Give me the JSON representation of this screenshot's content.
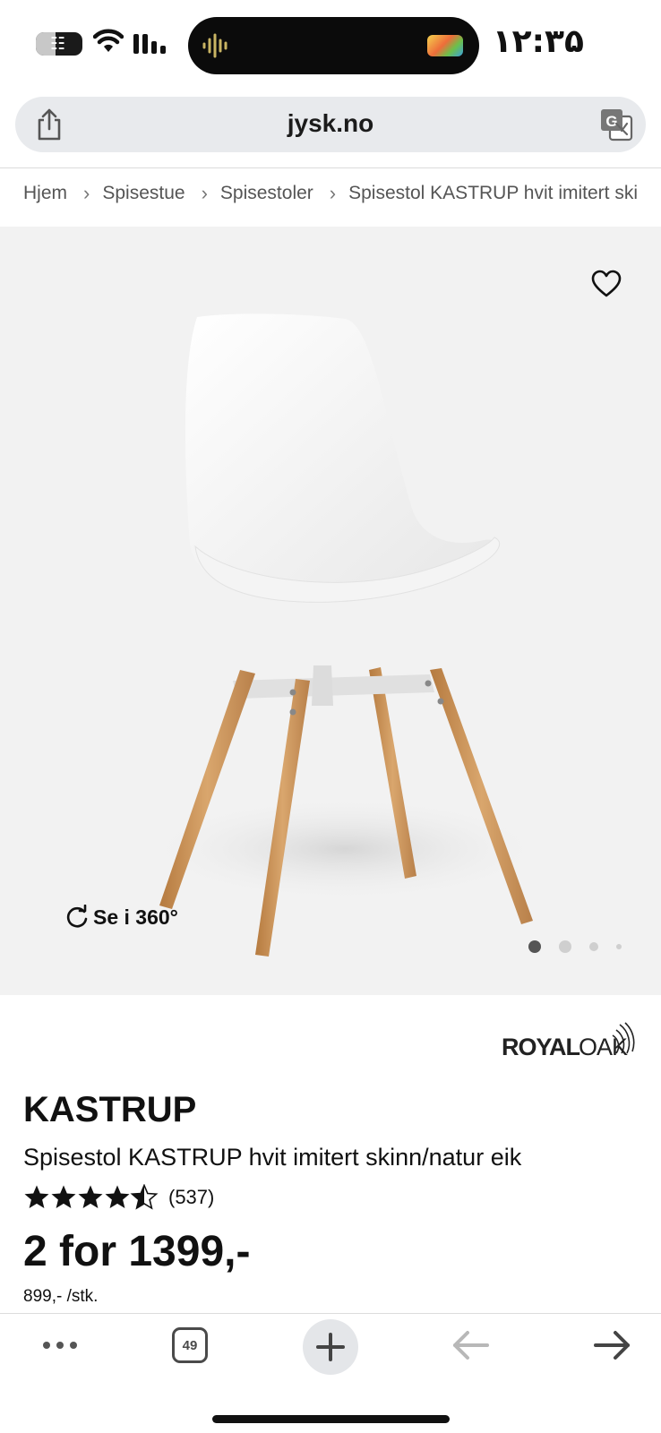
{
  "status_bar": {
    "time": "۱۲:۳۵",
    "battery_glyph": "☷"
  },
  "browser": {
    "url": "jysk.no",
    "tab_count": "49"
  },
  "breadcrumb": {
    "items": [
      "Hjem",
      "Spisestue",
      "Spisestoler",
      "Spisestol KASTRUP hvit imitert skinn/natur eik"
    ],
    "separator": "›"
  },
  "media": {
    "view_360_label": "Se i 360°",
    "carousel": {
      "total": 4,
      "active": 1
    }
  },
  "product": {
    "brand": "ROYAL OAK",
    "title": "KASTRUP",
    "subtitle": "Spisestol KASTRUP hvit imitert skinn/natur eik",
    "rating": {
      "value": 4.5,
      "max": 5,
      "count": "(537)"
    },
    "price": "2 for 1399,-",
    "unit_price": "899,- /stk."
  },
  "colors": {
    "media_bg": "#f2f2f2",
    "address_bar_bg": "#e8eaed",
    "text": "#111111",
    "wood": "#c9955c"
  },
  "icons": [
    "share-icon",
    "translate-icon",
    "heart-icon",
    "rotate-icon",
    "star-icon",
    "more-icon",
    "tabs-icon",
    "plus-icon",
    "back-arrow-icon",
    "forward-arrow-icon"
  ]
}
